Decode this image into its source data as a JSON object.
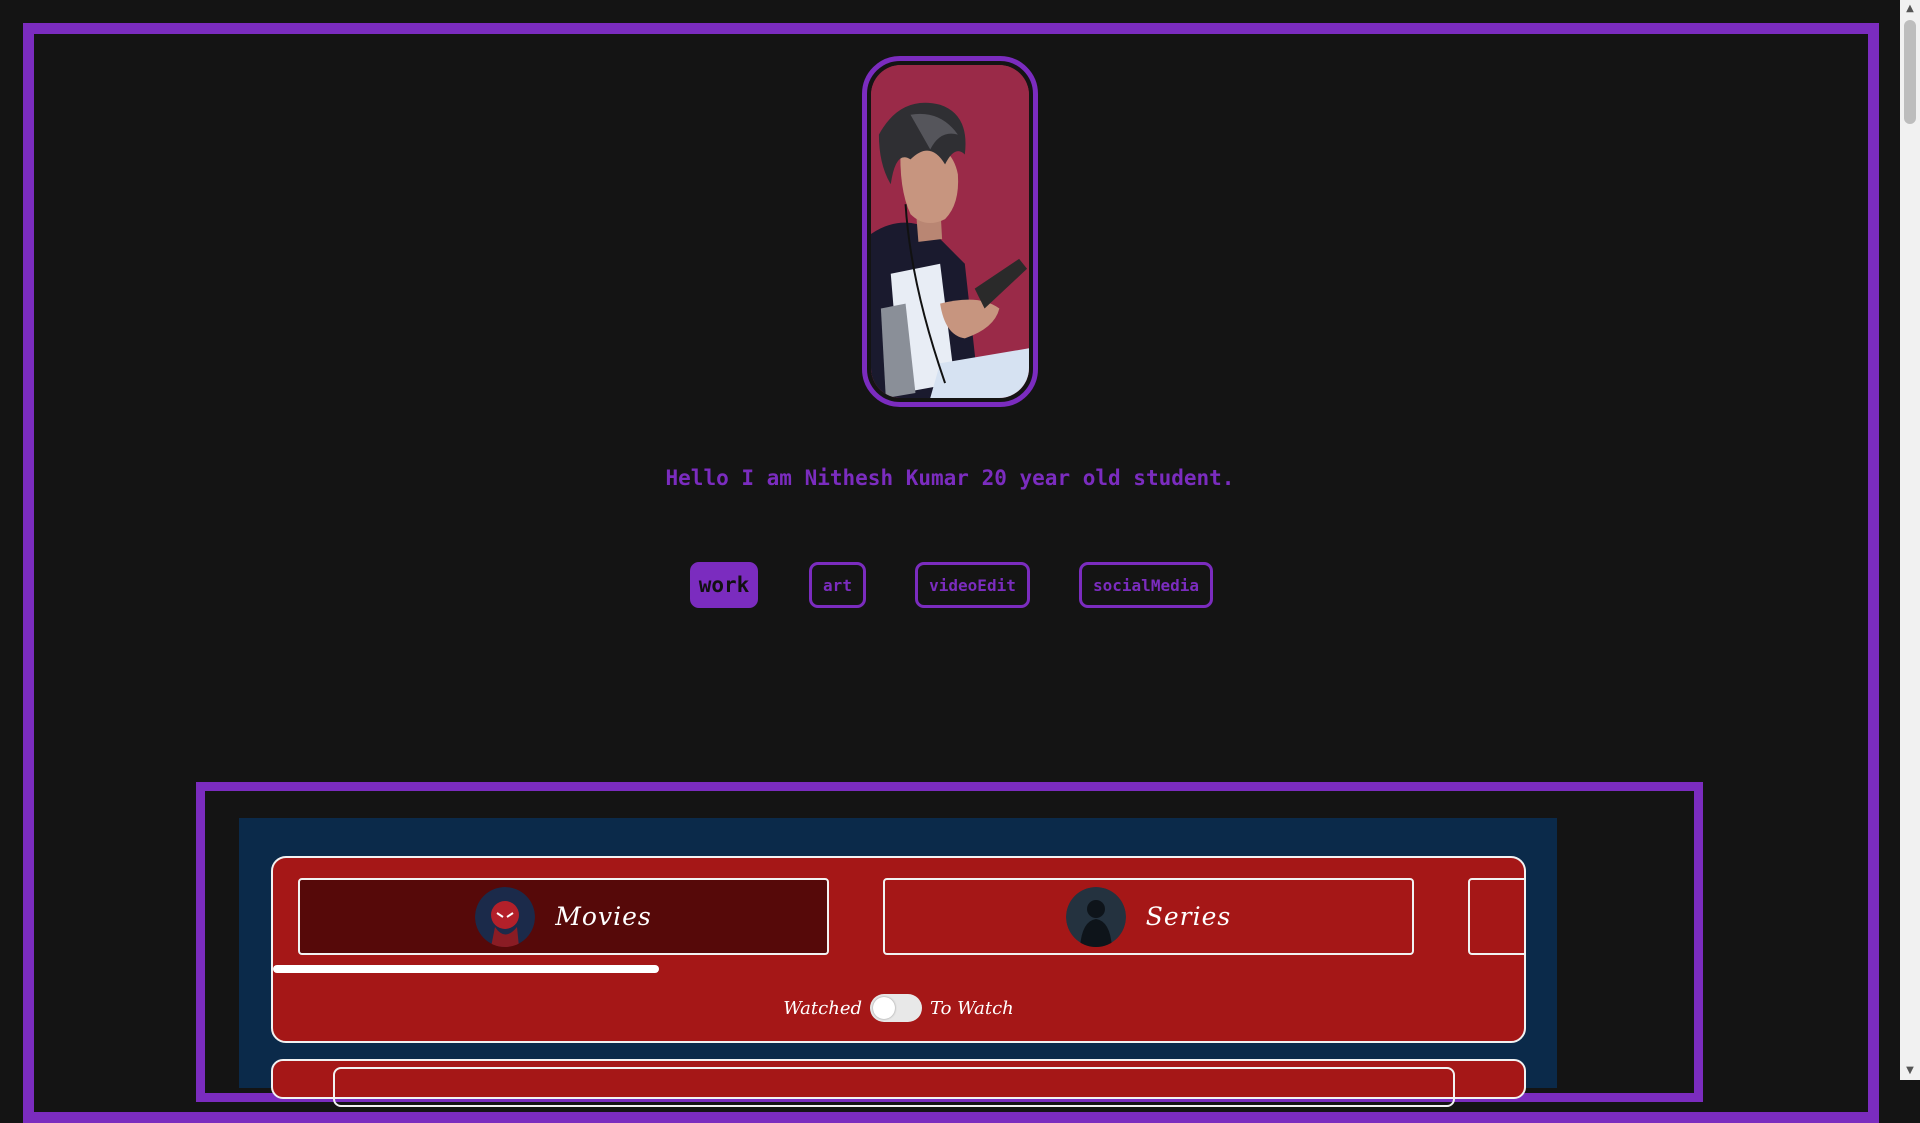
{
  "intro": {
    "text": "Hello I am Nithesh Kumar 20 year old student."
  },
  "nav": [
    {
      "label": "work",
      "active": true
    },
    {
      "label": "art",
      "active": false
    },
    {
      "label": "videoEdit",
      "active": false
    },
    {
      "label": "socialMedia",
      "active": false
    }
  ],
  "media": {
    "tabs": [
      {
        "label": "Movies",
        "selected": true
      },
      {
        "label": "Series",
        "selected": false
      }
    ],
    "toggle": {
      "left_label": "Watched",
      "right_label": "To Watch",
      "on": false
    }
  },
  "colors": {
    "accent": "#7b2cbf",
    "background": "#141414",
    "panel_blue": "#0b2a4a",
    "card_red": "#a51717",
    "tab_selected": "#560909"
  },
  "icons": [
    "avatar-illustration",
    "movies-thumbnail",
    "series-thumbnail"
  ]
}
